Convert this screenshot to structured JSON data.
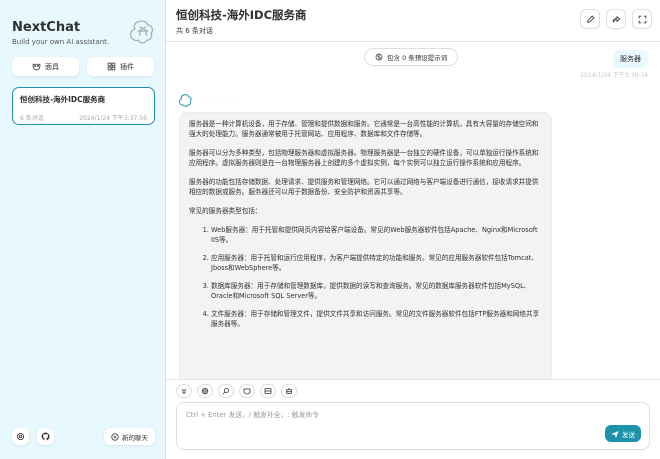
{
  "sidebar": {
    "title": "NextChat",
    "subtitle": "Build your own AI assistant.",
    "mask_button": "面具",
    "plugin_button": "插件",
    "chats": [
      {
        "title": "恒创科技-海外IDC服务商",
        "count": "6 条对话",
        "time": "2024/1/24 下午3:37:56"
      }
    ],
    "new_chat": "新的聊天"
  },
  "header": {
    "title": "恒创科技-海外IDC服务商",
    "subtitle": "共 6 条对话"
  },
  "conversation": {
    "prompt_pill": "包含 0 条预设提示词",
    "user_message": "服务器",
    "user_time": "2024/1/24 下午3:36:34",
    "bot_paragraphs": [
      "服务器是一种计算机设备，用于存储、管理和提供数据和服务。它通常是一台高性能的计算机，具有大容量的存储空间和强大的处理能力。服务器通常被用于托管网站、应用程序、数据库和文件存储等。",
      "服务器可以分为多种类型，包括物理服务器和虚拟服务器。物理服务器是一台独立的硬件设备，可以单独运行操作系统和应用程序。虚拟服务器则是在一台物理服务器上创建的多个虚拟实例，每个实例可以独立运行操作系统和应用程序。",
      "服务器的功能包括存储数据、处理请求、提供服务和管理网络。它可以通过网络与客户端设备进行通信，接收请求并提供相应的数据或服务。服务器还可以用于数据备份、安全防护和资源共享等。",
      "常见的服务器类型包括："
    ],
    "bot_list": [
      "Web服务器：用于托管和提供网页内容给客户端设备。常见的Web服务器软件包括Apache、Nginx和Microsoft IIS等。",
      "应用服务器：用于托管和运行应用程序，为客户端提供特定的功能和服务。常见的应用服务器软件包括Tomcat、Jboss和WebSphere等。",
      "数据库服务器：用于存储和管理数据库，提供数据的读写和查询服务。常见的数据库服务器软件包括MySQL、Oracle和Microsoft SQL Server等。",
      "文件服务器：用于存储和管理文件，提供文件共享和访问服务。常见的文件服务器软件包括FTP服务器和网络共享服务器等。"
    ]
  },
  "input": {
    "placeholder": "Ctrl + Enter 发送，/ 触发补全，: 触发命令",
    "send_label": "发送"
  },
  "colors": {
    "accent": "#1d93ab",
    "sidebar_bg": "#e7f8ff"
  }
}
